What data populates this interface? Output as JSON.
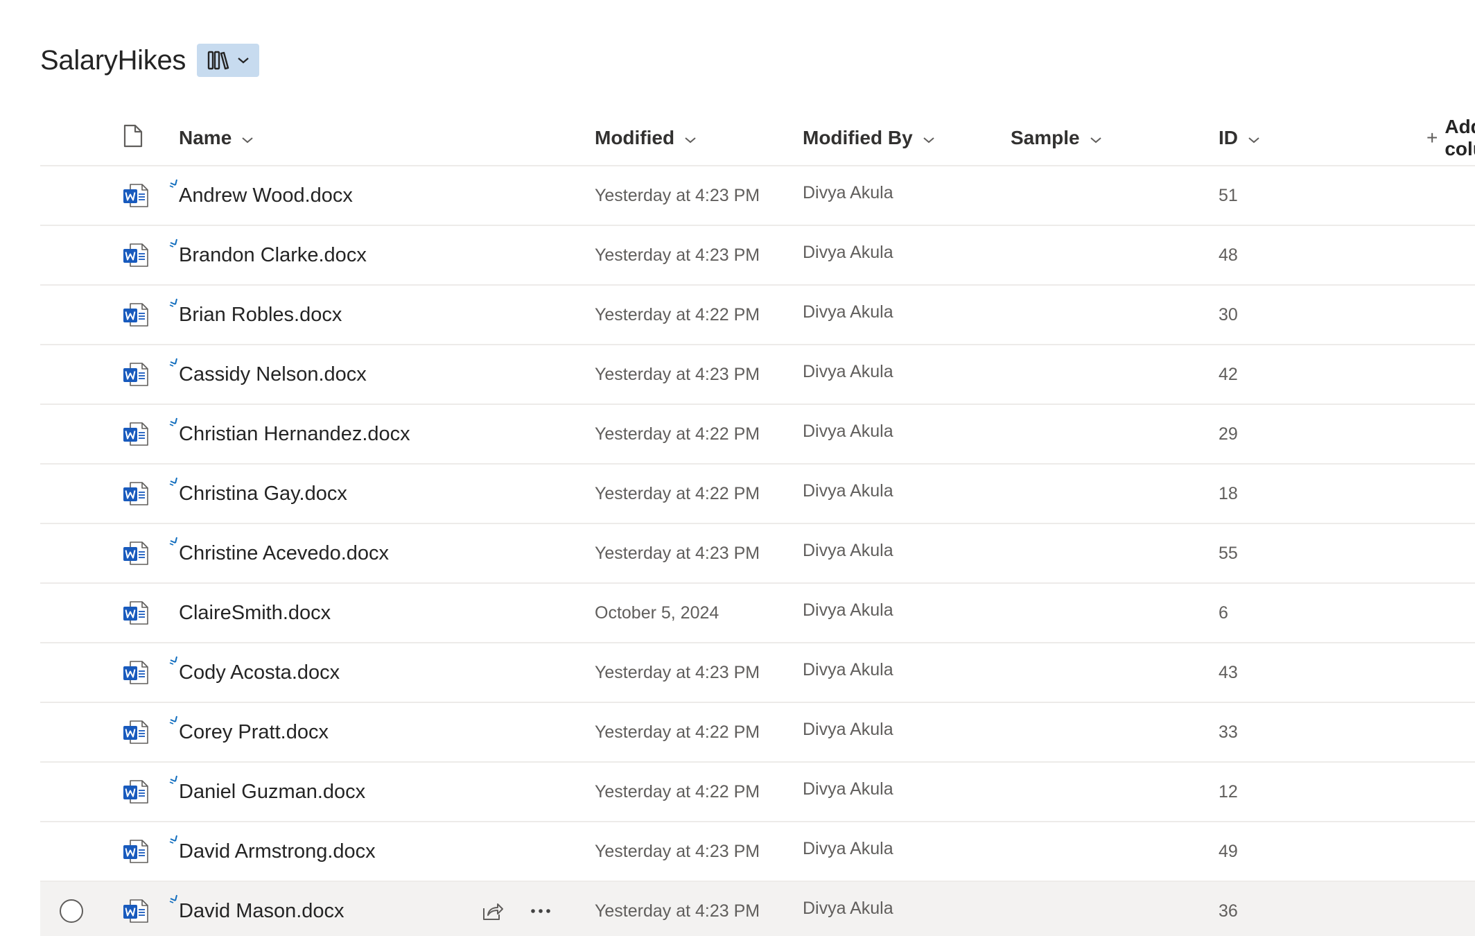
{
  "library": {
    "title": "SalaryHikes",
    "view_switcher_icon": "library-icon"
  },
  "columns": {
    "file_type_icon": "document-icon",
    "name": "Name",
    "modified": "Modified",
    "modified_by": "Modified By",
    "sample": "Sample",
    "id": "ID",
    "add_column": "Add column"
  },
  "rows": [
    {
      "name": "Andrew Wood.docx",
      "modified": "Yesterday at 4:23 PM",
      "modified_by": "Divya Akula",
      "id": "51",
      "new": true
    },
    {
      "name": "Brandon Clarke.docx",
      "modified": "Yesterday at 4:23 PM",
      "modified_by": "Divya Akula",
      "id": "48",
      "new": true
    },
    {
      "name": "Brian Robles.docx",
      "modified": "Yesterday at 4:22 PM",
      "modified_by": "Divya Akula",
      "id": "30",
      "new": true
    },
    {
      "name": "Cassidy Nelson.docx",
      "modified": "Yesterday at 4:23 PM",
      "modified_by": "Divya Akula",
      "id": "42",
      "new": true
    },
    {
      "name": "Christian Hernandez.docx",
      "modified": "Yesterday at 4:22 PM",
      "modified_by": "Divya Akula",
      "id": "29",
      "new": true
    },
    {
      "name": "Christina Gay.docx",
      "modified": "Yesterday at 4:22 PM",
      "modified_by": "Divya Akula",
      "id": "18",
      "new": true
    },
    {
      "name": "Christine Acevedo.docx",
      "modified": "Yesterday at 4:23 PM",
      "modified_by": "Divya Akula",
      "id": "55",
      "new": true
    },
    {
      "name": "ClaireSmith.docx",
      "modified": "October 5, 2024",
      "modified_by": "Divya Akula",
      "id": "6",
      "new": false
    },
    {
      "name": "Cody Acosta.docx",
      "modified": "Yesterday at 4:23 PM",
      "modified_by": "Divya Akula",
      "id": "43",
      "new": true
    },
    {
      "name": "Corey Pratt.docx",
      "modified": "Yesterday at 4:22 PM",
      "modified_by": "Divya Akula",
      "id": "33",
      "new": true
    },
    {
      "name": "Daniel Guzman.docx",
      "modified": "Yesterday at 4:22 PM",
      "modified_by": "Divya Akula",
      "id": "12",
      "new": true
    },
    {
      "name": "David Armstrong.docx",
      "modified": "Yesterday at 4:23 PM",
      "modified_by": "Divya Akula",
      "id": "49",
      "new": true
    },
    {
      "name": "David Mason.docx",
      "modified": "Yesterday at 4:23 PM",
      "modified_by": "Divya Akula",
      "id": "36",
      "new": true,
      "hovered": true
    }
  ],
  "colors": {
    "word_blue": "#185abd",
    "hover_row": "#f3f2f1",
    "view_switch_bg": "#c7dbef",
    "new_mark": "#0f6cbd"
  }
}
